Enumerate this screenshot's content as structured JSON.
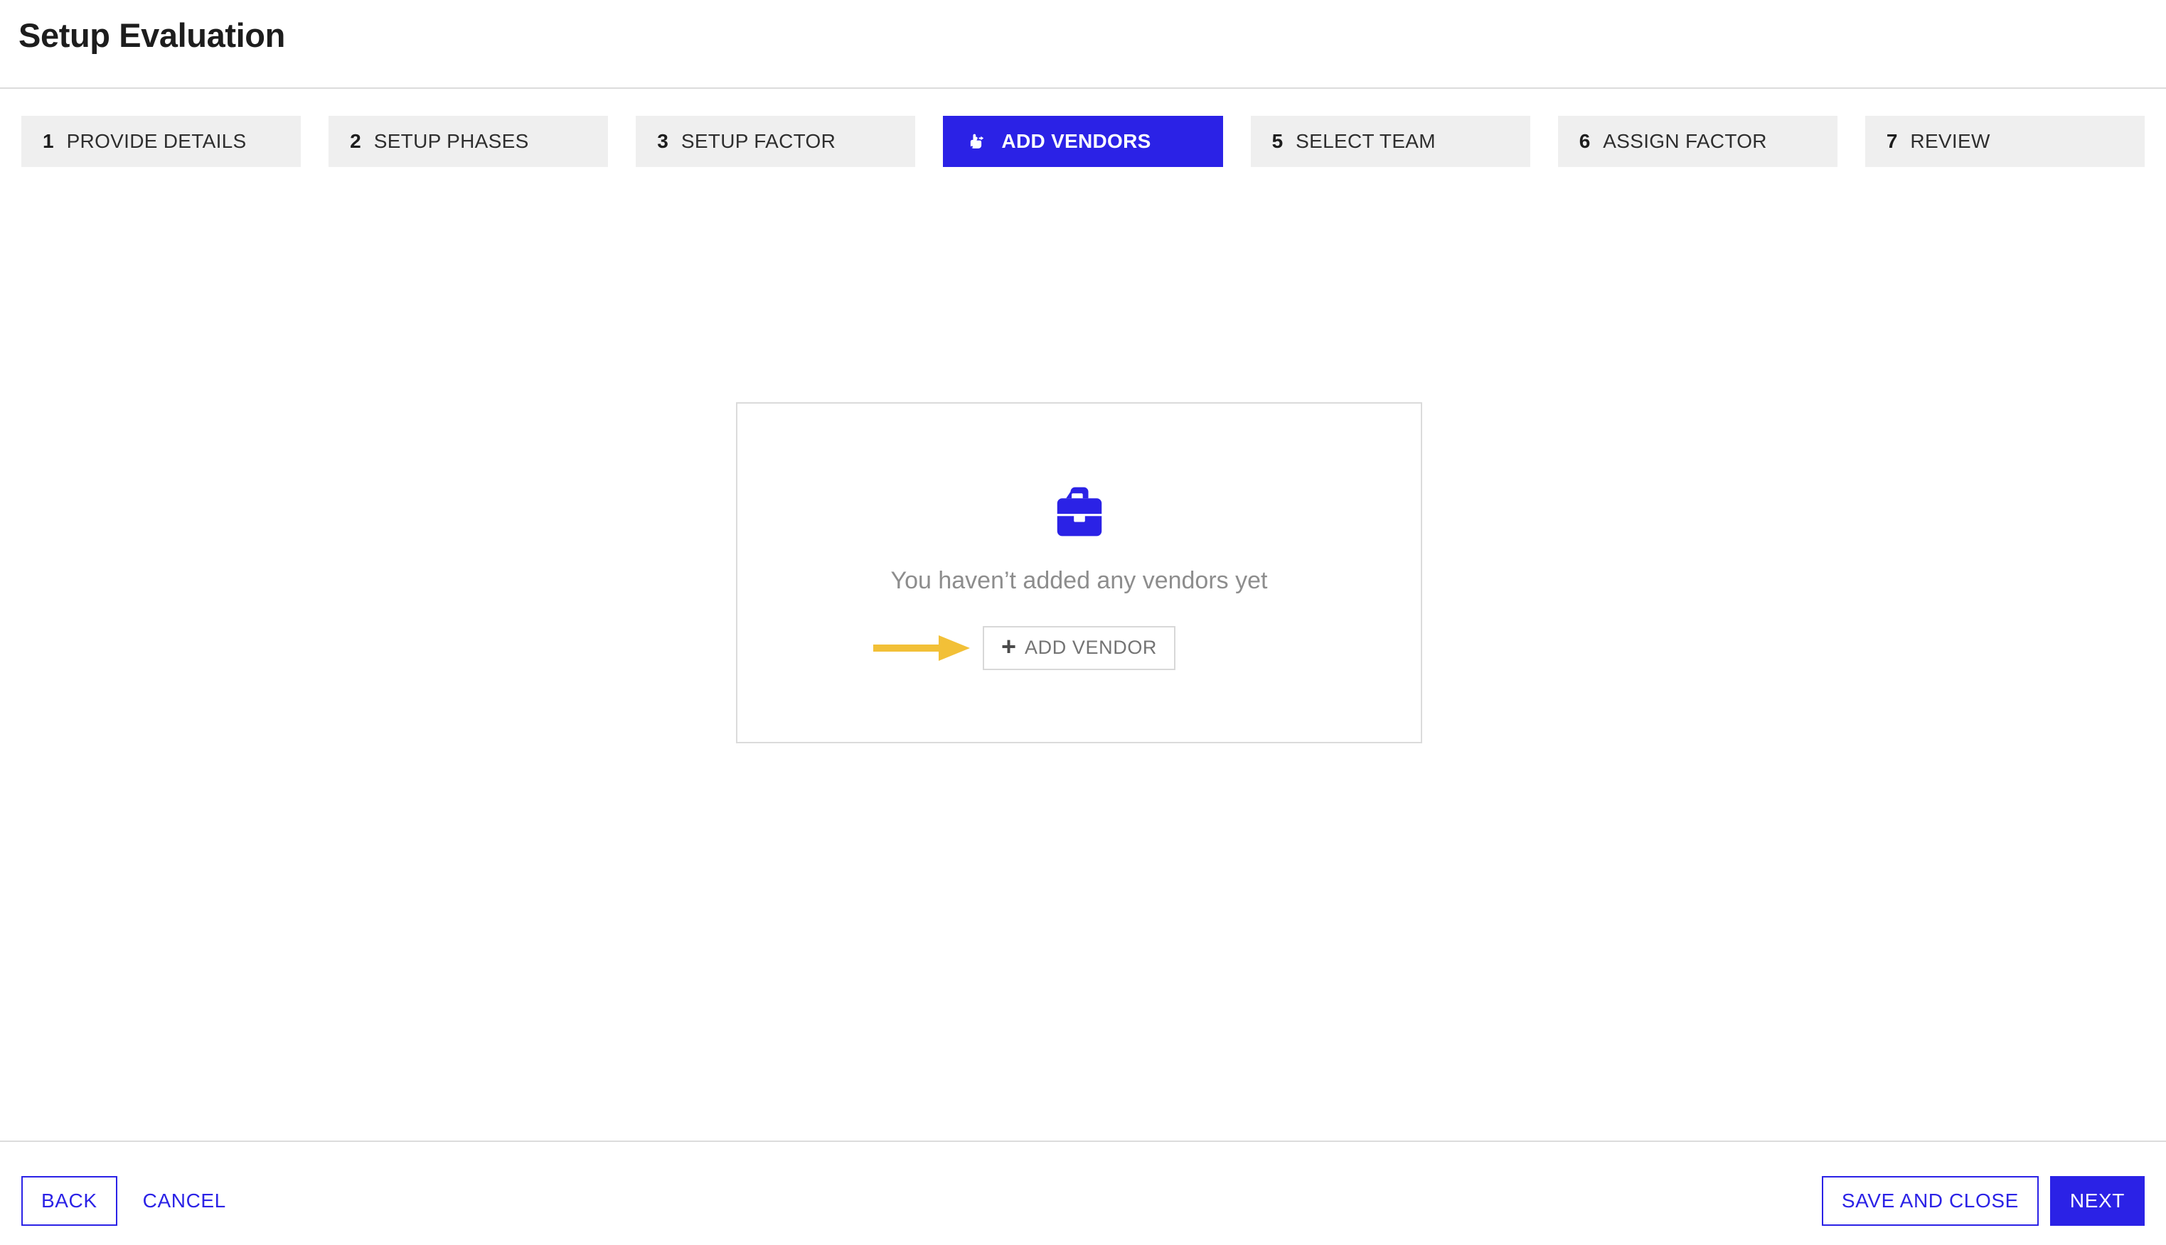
{
  "header": {
    "title": "Setup Evaluation"
  },
  "theme": {
    "accent": "#2b22e6",
    "step_inactive_bg": "#efefef",
    "arrow_color": "#f2c037",
    "border": "#dcdcdc",
    "muted_text": "#8d8d8d"
  },
  "stepper": {
    "steps": [
      {
        "number": "1",
        "label": "PROVIDE DETAILS",
        "active": false
      },
      {
        "number": "2",
        "label": "SETUP PHASES",
        "active": false
      },
      {
        "number": "3",
        "label": "SETUP FACTOR",
        "active": false
      },
      {
        "number": "",
        "label": "ADD VENDORS",
        "active": true,
        "icon": "pointing-hand-icon"
      },
      {
        "number": "5",
        "label": "SELECT TEAM",
        "active": false
      },
      {
        "number": "6",
        "label": "ASSIGN FACTOR",
        "active": false
      },
      {
        "number": "7",
        "label": "REVIEW",
        "active": false
      }
    ]
  },
  "main": {
    "empty_state": {
      "icon": "briefcase-icon",
      "message": "You haven’t added any vendors yet",
      "add_button_label": "ADD VENDOR",
      "add_button_plus": "+",
      "annotation": "arrow-pointing-to-add-vendor"
    }
  },
  "footer": {
    "back_label": "BACK",
    "cancel_label": "CANCEL",
    "save_and_close_label": "SAVE AND CLOSE",
    "next_label": "NEXT"
  }
}
